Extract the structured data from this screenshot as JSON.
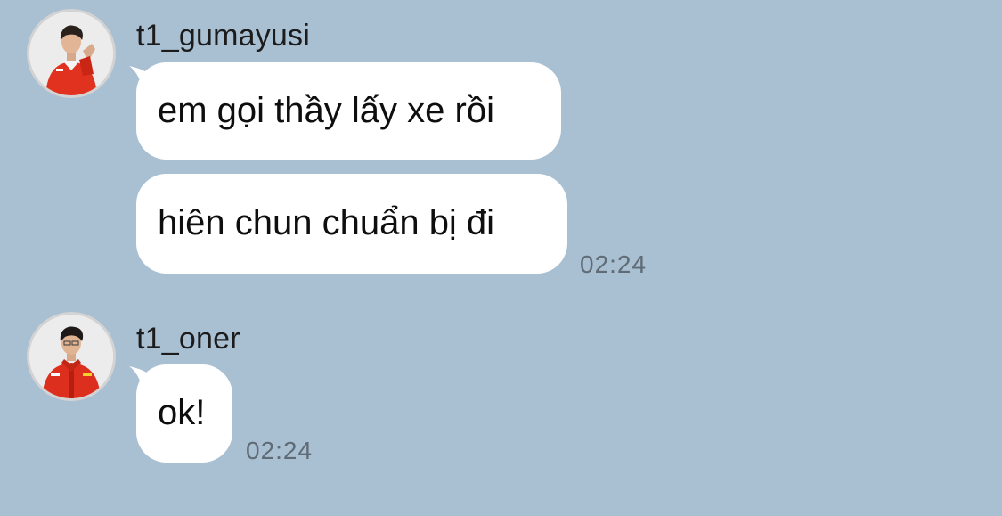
{
  "conversation": {
    "background_color": "#a9bfd2",
    "bubble_color": "#ffffff",
    "messages": [
      {
        "sender": "t1_gumayusi",
        "avatar_icon": "person-in-red-jacket-avatar",
        "lines": [
          "em gọi thầy lấy xe rồi",
          "hiên chun chuẩn bị đi"
        ],
        "time": "02:24"
      },
      {
        "sender": "t1_oner",
        "avatar_icon": "person-in-red-jacket-avatar",
        "lines": [
          "ok!"
        ],
        "time": "02:24"
      }
    ]
  }
}
